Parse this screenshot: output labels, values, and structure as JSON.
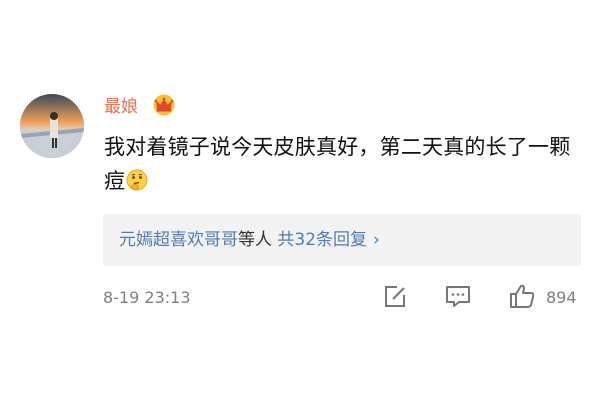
{
  "comment": {
    "username": "最娘",
    "text": "我对着镜子说今天皮肤真好，第二天真的长了一颗痘",
    "emoji_icon": "thinking-face-emoji",
    "badge_icon": "crown-icon"
  },
  "replies": {
    "users": "元嫣超喜欢哥哥",
    "others": "等人",
    "count_label": "共32条回复",
    "chevron": "›"
  },
  "meta": {
    "timestamp": "8-19 23:13",
    "like_count": "894"
  },
  "colors": {
    "username": "#eb7350",
    "link": "#507daf",
    "meta": "#808080",
    "reply_bg": "#f2f2f2"
  }
}
